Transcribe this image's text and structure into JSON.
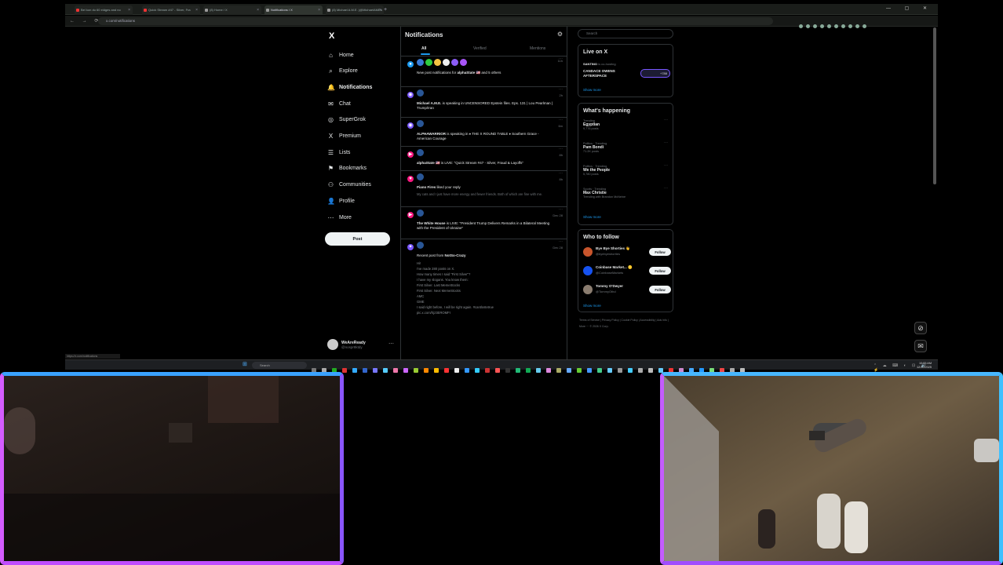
{
  "browser": {
    "tabs": [
      {
        "title": "Bel kon du 60 eidges and no",
        "favicon_color": "#e33"
      },
      {
        "title": "Quick Stream #47 - Silver, Fra",
        "favicon_color": "#e33"
      },
      {
        "title": "(8) Home / X",
        "favicon_color": "#999"
      },
      {
        "title": "Notifications / X",
        "favicon_color": "#999",
        "active": true
      },
      {
        "title": "(8) Michael A.M.E. (@MichaelAMEa",
        "favicon_color": "#999"
      }
    ],
    "new_tab": "+",
    "window_controls": "— ▢ ✕",
    "nav_buttons": "← → ⟳",
    "url": "x.com/notifications"
  },
  "x": {
    "logo": "X",
    "nav": [
      {
        "icon": "⌂",
        "icon_name": "home-icon",
        "label": "Home"
      },
      {
        "icon": "⌕",
        "icon_name": "search-icon",
        "label": "Explore"
      },
      {
        "icon": "🔔",
        "icon_name": "bell-icon",
        "label": "Notifications",
        "selected": true
      },
      {
        "icon": "✉",
        "icon_name": "mail-icon",
        "label": "Chat"
      },
      {
        "icon": "◎",
        "icon_name": "grok-icon",
        "label": "SuperGrok"
      },
      {
        "icon": "X",
        "icon_name": "x-premium-icon",
        "label": "Premium"
      },
      {
        "icon": "☰",
        "icon_name": "list-icon",
        "label": "Lists"
      },
      {
        "icon": "⚑",
        "icon_name": "bookmark-icon",
        "label": "Bookmarks"
      },
      {
        "icon": "⚇",
        "icon_name": "communities-icon",
        "label": "Communities"
      },
      {
        "icon": "👤",
        "icon_name": "profile-icon",
        "label": "Profile"
      },
      {
        "icon": "⋯",
        "icon_name": "more-icon",
        "label": "More"
      }
    ],
    "post_button": "Post",
    "account": {
      "name": "WeAreReady",
      "handle": "@nospr8ktdy",
      "more": "⋯"
    },
    "notifications": {
      "title": "Notifications",
      "tabs": [
        "All",
        "Verified",
        "Mentions"
      ],
      "items": [
        {
          "type": "bell",
          "time": "11h",
          "text_pre": "New post notifications for ",
          "bold": "alphaState 🇺🇸",
          "text_post": " and 5 others"
        },
        {
          "type": "space",
          "time": "2h",
          "bold": "Michael A.M.E.",
          "text_pre": "",
          "text_post": " is speaking in UNCENSORED Epstein files. Eps. 131 | Lou Pearlman | Trump/Iran"
        },
        {
          "type": "space",
          "time": "6m",
          "bold": "ALPHAWARRIOR",
          "text_pre": "",
          "text_post": " is speaking in ♦ THE X ROUND TABLE ♦ Southern Grace - American Courage"
        },
        {
          "type": "live",
          "time": "8h",
          "bold": "alphaState 🇺🇸",
          "text_pre": "",
          "text_post": " is LIVE: \"Quick Stream #47 - Silver, Fraud & Layoffs\""
        },
        {
          "type": "like",
          "time": "8h",
          "bold": "Piano Fires",
          "text_pre": "",
          "text_post": " liked your reply",
          "sub": "My cats and I just have more energy and fewer friends. Both of which are fine with me."
        },
        {
          "type": "live",
          "time": "Dec 28",
          "bold": "The White House",
          "text_pre": "",
          "text_post": " is LIVE: \"President Trump Delivers Remarks in a Bilateral Meeting with the President of Ukraine\""
        },
        {
          "type": "sparkle",
          "time": "Dec 28",
          "text_pre": "Recent post from ",
          "bold": "NotSo-Crazy",
          "text_post": "",
          "lines": [
            "Hi!",
            "I've made 280 posts on X.",
            "How many times I said \"First Silver\"?",
            "I have my slogans. You know them:",
            "First Silver. Last MemeStocks",
            "First Silver. Next MemeStocks",
            "AMC",
            "GME",
            "I said right before, I will be right again. #cantlostetrue",
            "pic.x.com/hjz3EROMFI"
          ]
        }
      ]
    },
    "sidebar": {
      "search_placeholder": "Search",
      "live": {
        "title": "Live on X",
        "host": "SANTINO",
        "host_status": "is co-hosting",
        "show": "CANDACE OWENS AFTERSPACE",
        "listeners": "+788",
        "show_more": "Show more"
      },
      "happening": {
        "title": "What's happening",
        "trends": [
          {
            "category": "Trending",
            "name": "Egyptian",
            "count": "9,776 posts"
          },
          {
            "category": "Politics · Trending",
            "name": "Pam Bondi",
            "count": "71.2K posts"
          },
          {
            "category": "Politics · Trending",
            "name": "We the People",
            "count": "5,780 posts"
          },
          {
            "category": "Sports · Trending",
            "name": "Max Christie",
            "count": "Trending with Brandon McNeine"
          }
        ],
        "show_more": "Show more"
      },
      "who_to_follow": {
        "title": "Who to follow",
        "accounts": [
          {
            "name": "Bye Bye Shorties 👋",
            "handle": "@byebyeshorties",
            "avatar_color": "#c8552c"
          },
          {
            "name": "Coinbase Market... 🟡",
            "handle": "@CoinbaseMarkets",
            "avatar_color": "#1652f0"
          },
          {
            "name": "Tommy O'Dwyer",
            "handle": "@TommyOthd",
            "avatar_color": "#8b7d70"
          }
        ],
        "follow_label": "Follow",
        "show_more": "Show more"
      },
      "footer": "Terms of Service | Privacy Policy | Cookie Policy | Accessibility | Ads info | More ··· © 2026 X Corp."
    },
    "status_url": "https://x.com/notifications"
  },
  "taskbar": {
    "search_placeholder": "Search",
    "time": "10:23 AM",
    "date": "12/30/2025",
    "tray": "⌃ ☁ ⌨ ◐ ⊡ 🔊 ⚡",
    "app_colors": [
      "#777",
      "#aaa",
      "#2a2",
      "#d33",
      "#3af",
      "#36c",
      "#77f",
      "#5cf",
      "#e7a",
      "#c6f",
      "#9c3",
      "#f80",
      "#fb0",
      "#f33",
      "#eee",
      "#39f",
      "#3cf",
      "#c33",
      "#f55",
      "#333",
      "#2b7",
      "#1a5",
      "#6ce",
      "#d8d",
      "#aa6",
      "#6af",
      "#6c3",
      "#49f",
      "#4c8",
      "#6cf",
      "#999",
      "#4cf",
      "#aaa",
      "#bbb",
      "#6cf",
      "#e33",
      "#c8c",
      "#4af",
      "#29f",
      "#7d7",
      "#e44",
      "#aaa",
      "#bbb"
    ]
  },
  "colors": {
    "x_blue": "#1d9bf0",
    "live_pink": "#f91880",
    "space_purple": "#7856ff",
    "border": "#2f3336"
  }
}
